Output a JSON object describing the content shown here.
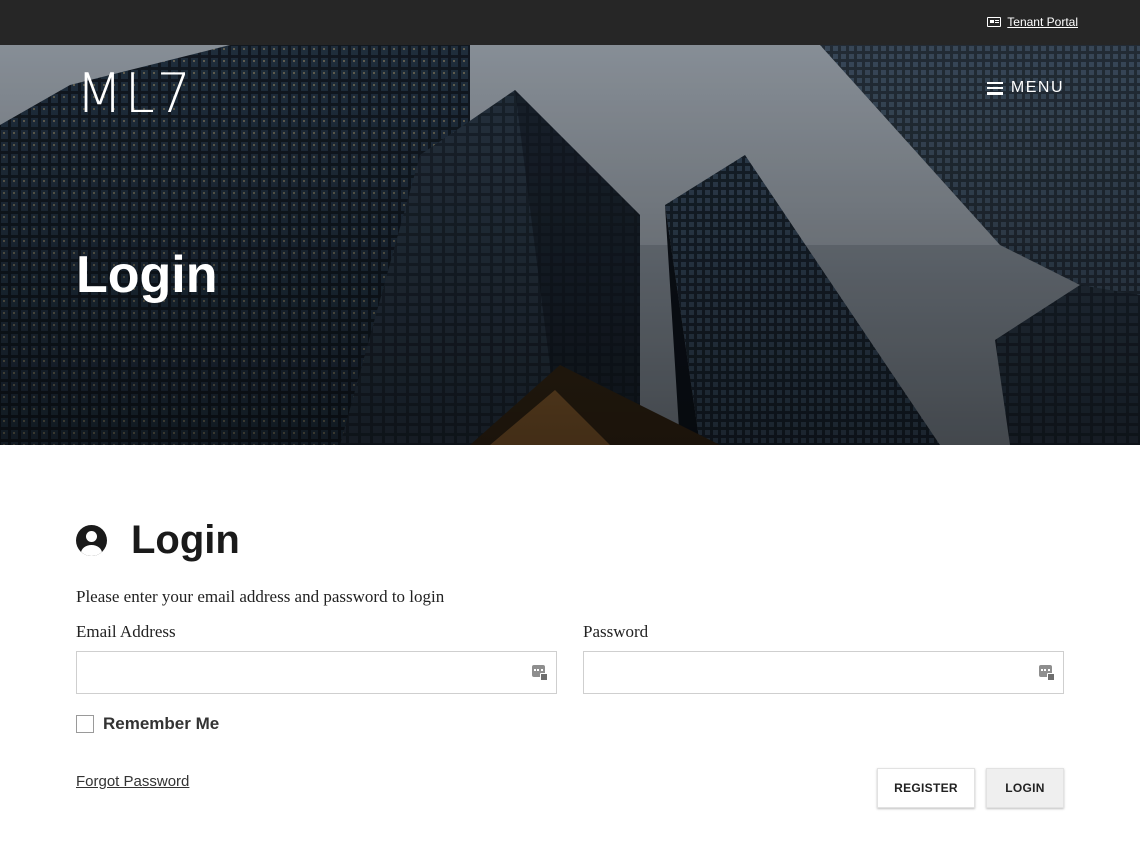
{
  "topbar": {
    "tenant_portal_label": "Tenant Portal",
    "icon": "id-card-icon"
  },
  "header": {
    "logo_text": "ML7",
    "menu_label": "MENU",
    "menu_icon": "hamburger-icon"
  },
  "hero": {
    "title": "Login",
    "background": "city-skyscrapers-photo"
  },
  "form": {
    "heading": "Login",
    "heading_icon": "user-circle-icon",
    "instructions": "Please enter your email address and password to login",
    "email": {
      "label": "Email Address",
      "value": "",
      "placeholder": "",
      "icon": "password-manager-icon"
    },
    "password": {
      "label": "Password",
      "value": "",
      "placeholder": "",
      "icon": "password-manager-icon"
    },
    "remember_me": {
      "label": "Remember Me",
      "checked": false
    },
    "forgot_password_label": "Forgot Password",
    "register_label": "REGISTER",
    "login_label": "LOGIN"
  },
  "colors": {
    "topbar_bg": "#262626",
    "text_dark": "#1a1a1a",
    "button_gray": "#efefef",
    "input_border": "#cfcfcf"
  }
}
